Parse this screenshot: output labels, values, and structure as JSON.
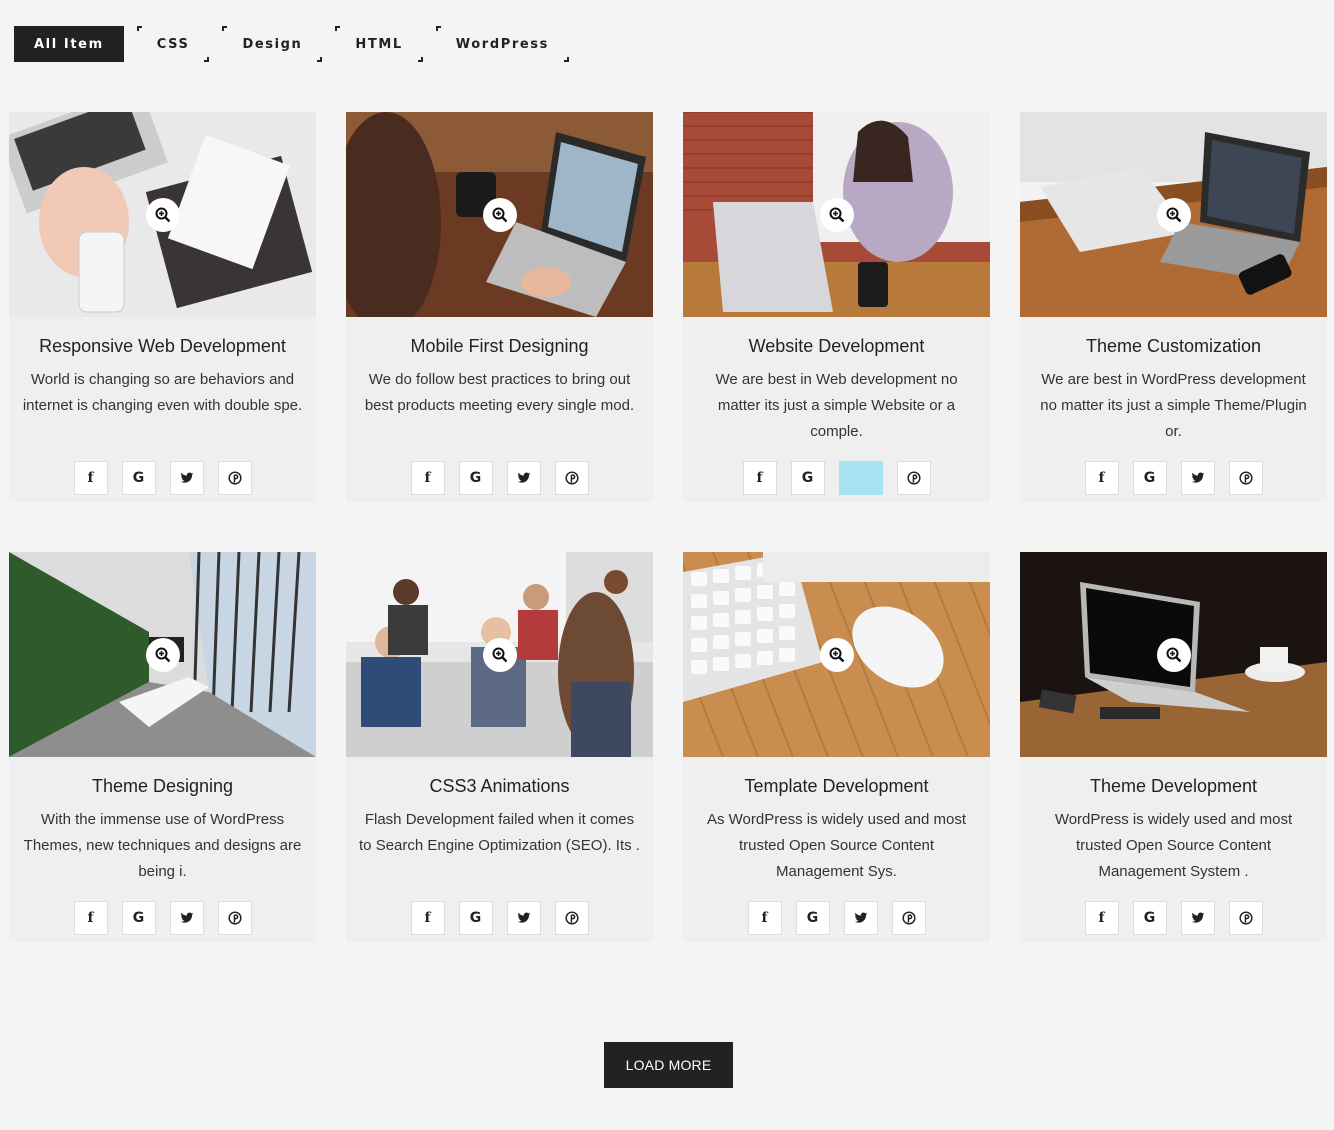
{
  "filters": [
    "All Item",
    "CSS",
    "Design",
    "HTML",
    "WordPress"
  ],
  "active_filter": "All Item",
  "cards": [
    {
      "title": "Responsive Web Development",
      "desc": "World is changing so are behaviors and internet is changing even with double spe.",
      "scene": "desk-white",
      "highlight": ""
    },
    {
      "title": "Mobile First Designing",
      "desc": "We do follow best practices to bring out best products meeting every single mod.",
      "scene": "laptop-cafe",
      "highlight": ""
    },
    {
      "title": "Website Development",
      "desc": "We are best in Web development no matter its just a simple Website or a comple.",
      "scene": "brick-office",
      "highlight": "twitter"
    },
    {
      "title": "Theme Customization",
      "desc": "We are best in WordPress development no matter its just a simple Theme/Plugin or.",
      "scene": "wood-desk",
      "highlight": ""
    },
    {
      "title": "Theme Designing",
      "desc": "With the immense use of WordPress Themes, new techniques and designs are being i.",
      "scene": "conference-room",
      "highlight": ""
    },
    {
      "title": "CSS3 Animations",
      "desc": "Flash Development failed when it comes to Search Engine Optimization (SEO). Its .",
      "scene": "team-meeting",
      "highlight": ""
    },
    {
      "title": "Template Development",
      "desc": "As WordPress is widely used and most trusted Open Source Content Management Sys.",
      "scene": "keyboard-mouse",
      "highlight": ""
    },
    {
      "title": "Theme Development",
      "desc": "WordPress is widely used and most trusted Open Source Content Management System .",
      "scene": "dark-laptop",
      "highlight": ""
    }
  ],
  "social_icons": [
    "facebook-icon",
    "google-icon",
    "twitter-icon",
    "pinterest-icon"
  ],
  "load_more_label": "LOAD MORE",
  "colors": {
    "accent": "#222222",
    "highlight": "#a6e3f3",
    "background": "#f4f4f4"
  }
}
